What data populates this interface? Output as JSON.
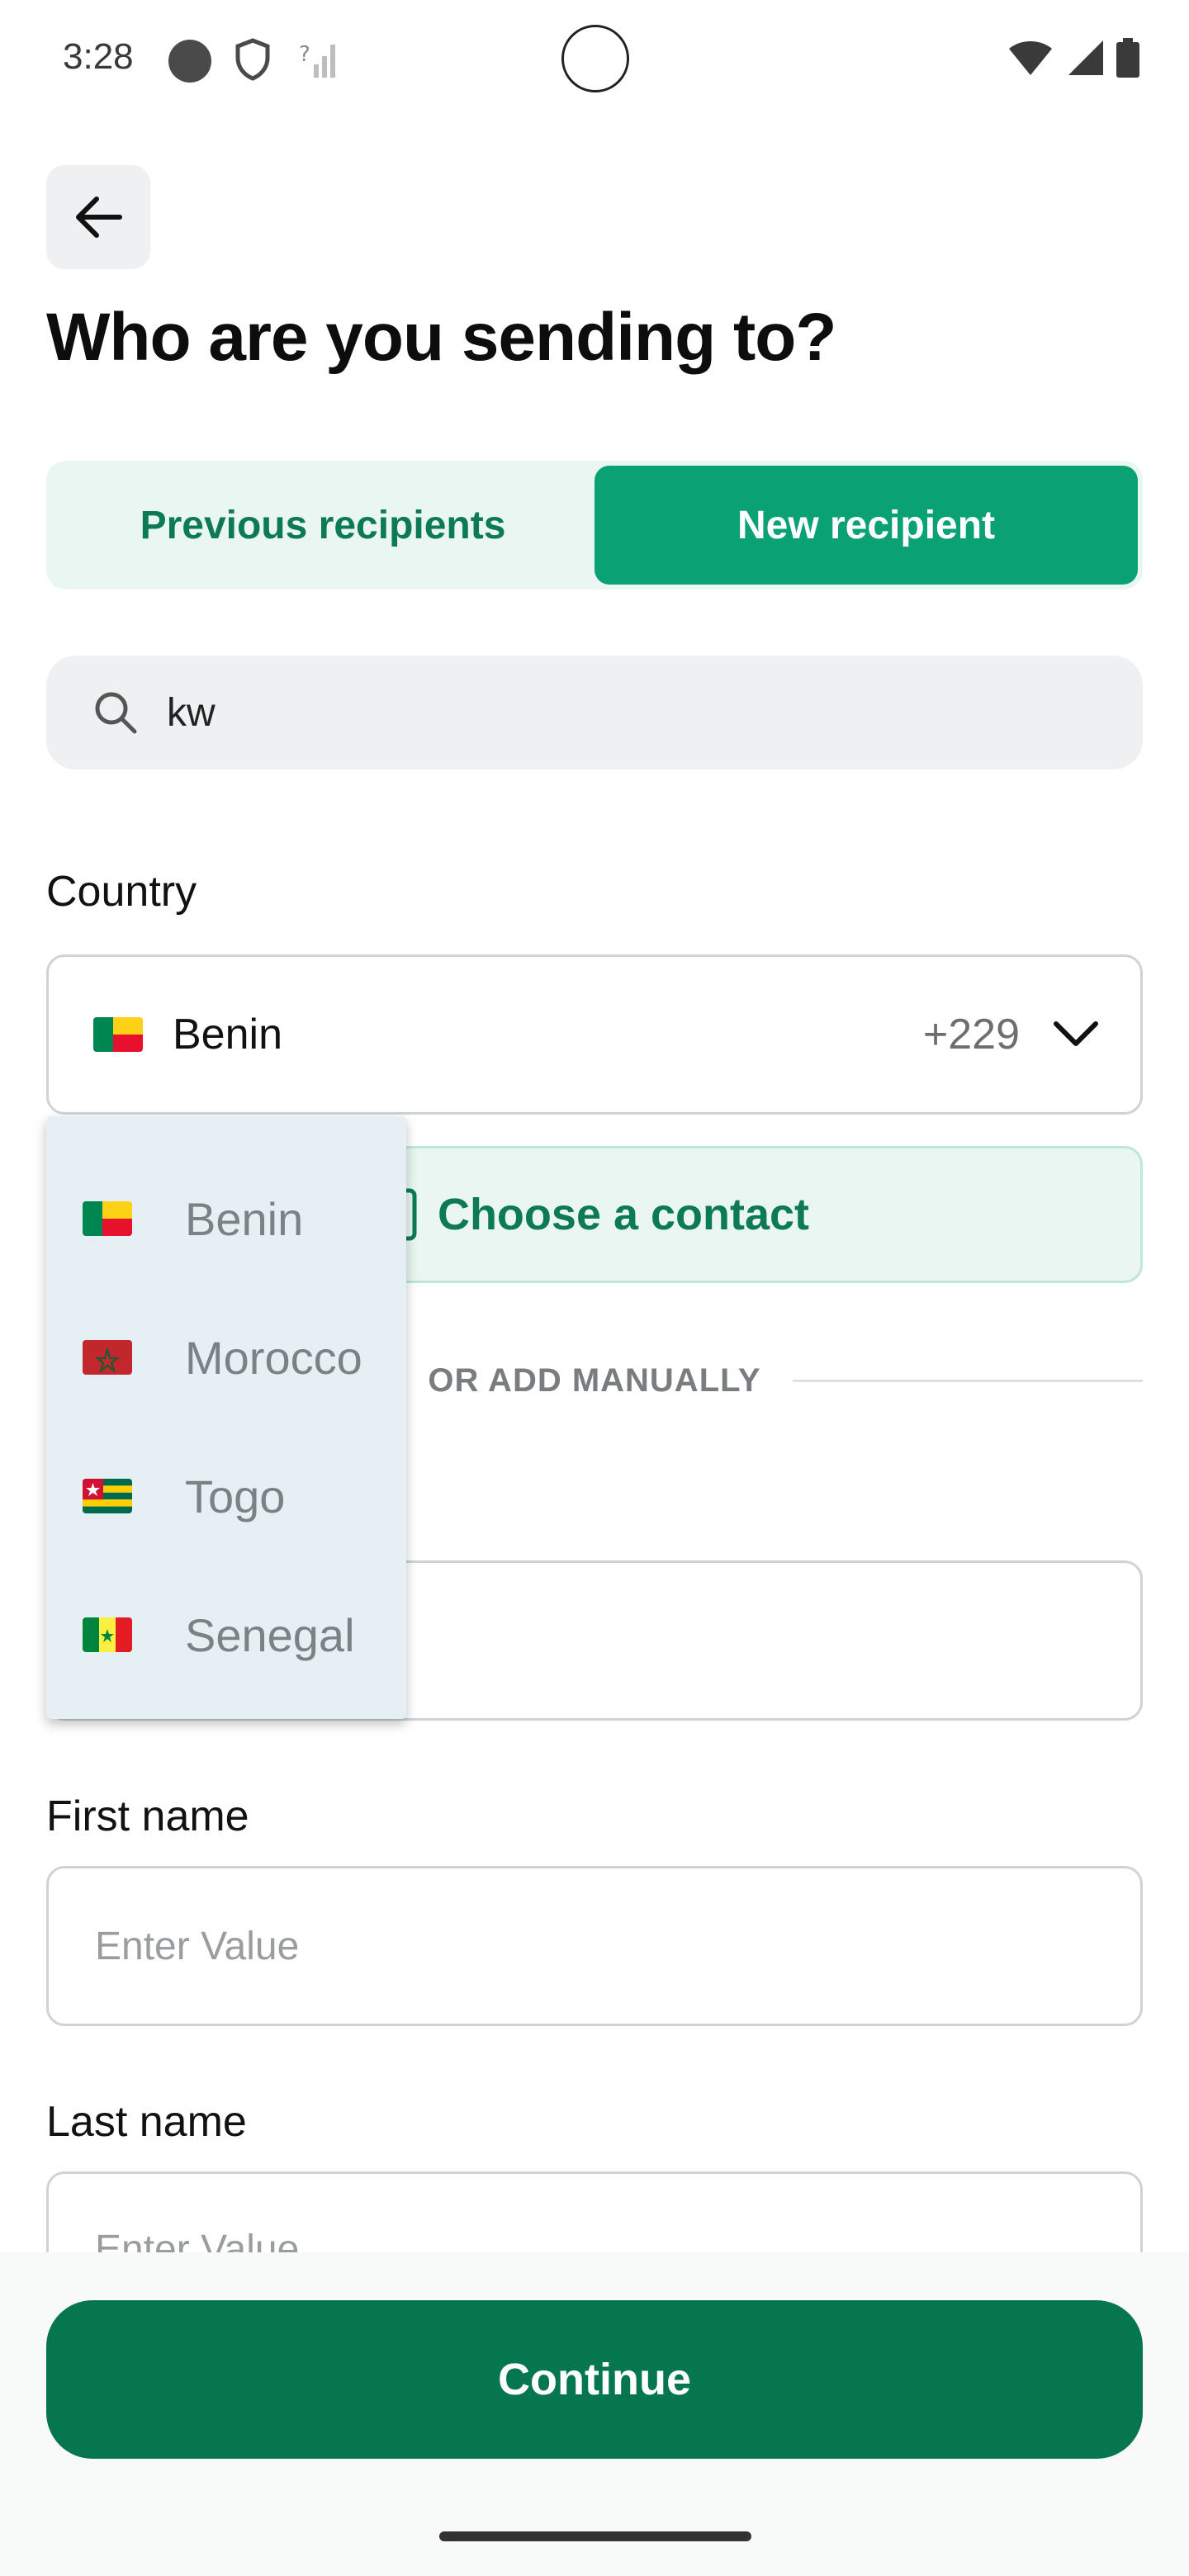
{
  "status_bar": {
    "time": "3:28"
  },
  "header": {
    "title": "Who are you sending to?"
  },
  "tabs": [
    {
      "label": "Previous recipients"
    },
    {
      "label": "New recipient"
    }
  ],
  "search": {
    "value": "kw"
  },
  "country": {
    "label": "Country",
    "selected_name": "Benin",
    "selected_code": "+229"
  },
  "contact": {
    "label": "Choose a contact"
  },
  "divider": {
    "text": "OR ADD MANUALLY"
  },
  "dropdown": {
    "items": [
      {
        "name": "Benin"
      },
      {
        "name": "Morocco"
      },
      {
        "name": "Togo"
      },
      {
        "name": "Senegal"
      }
    ]
  },
  "form": {
    "first_name_label": "First name",
    "first_name_placeholder": "Enter Value",
    "last_name_label": "Last name",
    "last_name_placeholder": "Enter Value"
  },
  "footer": {
    "continue_label": "Continue"
  },
  "colors": {
    "accent": "#0aa175",
    "accent_dark": "#06764f",
    "accent_light": "#e9f6f1"
  }
}
